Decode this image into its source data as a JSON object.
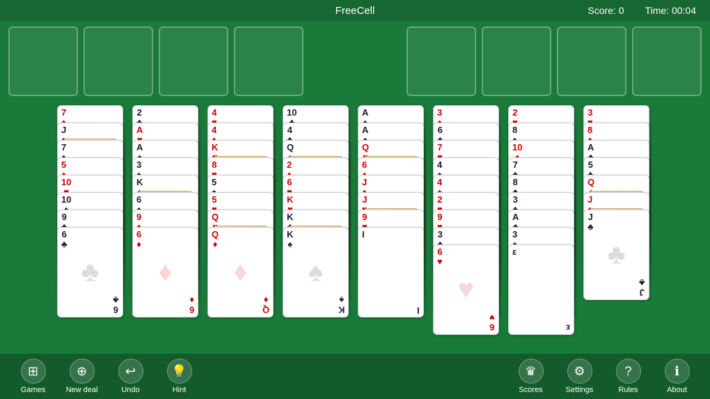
{
  "header": {
    "title": "FreeCell",
    "score_label": "Score:",
    "score_value": "0",
    "time_label": "Time:",
    "time_value": "00:04"
  },
  "toolbar": {
    "left_buttons": [
      {
        "id": "games",
        "label": "Games",
        "icon": "⊞"
      },
      {
        "id": "new-deal",
        "label": "New deal",
        "icon": "⊕"
      },
      {
        "id": "undo",
        "label": "Undo",
        "icon": "↩"
      },
      {
        "id": "hint",
        "label": "Hint",
        "icon": "💡"
      }
    ],
    "right_buttons": [
      {
        "id": "scores",
        "label": "Scores",
        "icon": "♛"
      },
      {
        "id": "settings",
        "label": "Settings",
        "icon": "⚙"
      },
      {
        "id": "rules",
        "label": "Rules",
        "icon": "?"
      },
      {
        "id": "about",
        "label": "About",
        "icon": "ℹ"
      }
    ]
  },
  "columns": [
    {
      "cards": [
        {
          "rank": "7",
          "suit": "♦",
          "color": "red",
          "face": false
        },
        {
          "rank": "J",
          "suit": "♠",
          "color": "black",
          "face": true
        },
        {
          "rank": "7",
          "suit": "♠",
          "color": "black",
          "face": false
        },
        {
          "rank": "5",
          "suit": "♦",
          "color": "red",
          "face": false
        },
        {
          "rank": "10",
          "suit": "♥",
          "color": "red",
          "face": false
        },
        {
          "rank": "10",
          "suit": "♠",
          "color": "black",
          "face": false
        },
        {
          "rank": "9",
          "suit": "♣",
          "color": "black",
          "face": false
        },
        {
          "rank": "6",
          "suit": "♣",
          "color": "black",
          "face": false
        }
      ]
    },
    {
      "cards": [
        {
          "rank": "2",
          "suit": "♣",
          "color": "black",
          "face": false
        },
        {
          "rank": "A",
          "suit": "♥",
          "color": "red",
          "face": false
        },
        {
          "rank": "A",
          "suit": "♠",
          "color": "black",
          "face": false
        },
        {
          "rank": "3",
          "suit": "♠",
          "color": "black",
          "face": false
        },
        {
          "rank": "K",
          "suit": "♠",
          "color": "black",
          "face": true
        },
        {
          "rank": "6",
          "suit": "♠",
          "color": "black",
          "face": false
        },
        {
          "rank": "9",
          "suit": "♦",
          "color": "red",
          "face": false
        },
        {
          "rank": "6",
          "suit": "♦",
          "color": "red",
          "face": false
        }
      ]
    },
    {
      "cards": [
        {
          "rank": "4",
          "suit": "♥",
          "color": "red",
          "face": false
        },
        {
          "rank": "4",
          "suit": "♦",
          "color": "red",
          "face": false
        },
        {
          "rank": "K",
          "suit": "♥",
          "color": "red",
          "face": true
        },
        {
          "rank": "8",
          "suit": "♥",
          "color": "red",
          "face": false
        },
        {
          "rank": "5",
          "suit": "♠",
          "color": "black",
          "face": false
        },
        {
          "rank": "5",
          "suit": "♥",
          "color": "red",
          "face": false
        },
        {
          "rank": "Q",
          "suit": "♥",
          "color": "red",
          "face": true
        },
        {
          "rank": "Q",
          "suit": "♦",
          "color": "red",
          "face": false
        }
      ]
    },
    {
      "cards": [
        {
          "rank": "10",
          "suit": "♣",
          "color": "black",
          "face": false
        },
        {
          "rank": "4",
          "suit": "♣",
          "color": "black",
          "face": false
        },
        {
          "rank": "Q",
          "suit": "♠",
          "color": "black",
          "face": true
        },
        {
          "rank": "2",
          "suit": "♦",
          "color": "red",
          "face": false
        },
        {
          "rank": "6",
          "suit": "♥",
          "color": "red",
          "face": false
        },
        {
          "rank": "K",
          "suit": "♥",
          "color": "red",
          "face": false
        },
        {
          "rank": "K",
          "suit": "♣",
          "color": "black",
          "face": true
        },
        {
          "rank": "K",
          "suit": "♠",
          "color": "black",
          "face": false
        }
      ]
    },
    {
      "cards": [
        {
          "rank": "A",
          "suit": "♠",
          "color": "black",
          "face": false
        },
        {
          "rank": "A",
          "suit": "♠",
          "color": "black",
          "face": false
        },
        {
          "rank": "Q",
          "suit": "♥",
          "color": "red",
          "face": true
        },
        {
          "rank": "6",
          "suit": "♦",
          "color": "red",
          "face": false
        },
        {
          "rank": "J",
          "suit": "♦",
          "color": "red",
          "face": false
        },
        {
          "rank": "J",
          "suit": "♥",
          "color": "red",
          "face": true
        },
        {
          "rank": "9",
          "suit": "♥",
          "color": "red",
          "face": false
        },
        {
          "rank": "I",
          "suit": "",
          "color": "black",
          "face": false
        }
      ]
    },
    {
      "cards": [
        {
          "rank": "3",
          "suit": "♦",
          "color": "red",
          "face": false
        },
        {
          "rank": "6",
          "suit": "♣",
          "color": "black",
          "face": false
        },
        {
          "rank": "7",
          "suit": "♥",
          "color": "red",
          "face": false
        },
        {
          "rank": "4",
          "suit": "♠",
          "color": "black",
          "face": false
        },
        {
          "rank": "4",
          "suit": "♦",
          "color": "red",
          "face": false
        },
        {
          "rank": "2",
          "suit": "♥",
          "color": "red",
          "face": false
        },
        {
          "rank": "9",
          "suit": "♥",
          "color": "red",
          "face": false
        },
        {
          "rank": "3",
          "suit": "♣",
          "color": "black",
          "face": false
        },
        {
          "rank": "6",
          "suit": "♥",
          "color": "red",
          "face": false
        }
      ]
    },
    {
      "cards": [
        {
          "rank": "2",
          "suit": "♥",
          "color": "red",
          "face": false
        },
        {
          "rank": "8",
          "suit": "♠",
          "color": "black",
          "face": false
        },
        {
          "rank": "10",
          "suit": "♦",
          "color": "red",
          "face": false
        },
        {
          "rank": "7",
          "suit": "♣",
          "color": "black",
          "face": false
        },
        {
          "rank": "8",
          "suit": "♣",
          "color": "black",
          "face": false
        },
        {
          "rank": "3",
          "suit": "♣",
          "color": "black",
          "face": false
        },
        {
          "rank": "A",
          "suit": "♣",
          "color": "black",
          "face": false
        },
        {
          "rank": "3",
          "suit": "♠",
          "color": "black",
          "face": false
        },
        {
          "rank": "ε",
          "suit": "",
          "color": "black",
          "face": false
        }
      ]
    },
    {
      "cards": [
        {
          "rank": "3",
          "suit": "♥",
          "color": "red",
          "face": false
        },
        {
          "rank": "8",
          "suit": "♦",
          "color": "red",
          "face": false
        },
        {
          "rank": "A",
          "suit": "♣",
          "color": "black",
          "face": false
        },
        {
          "rank": "5",
          "suit": "♣",
          "color": "black",
          "face": false
        },
        {
          "rank": "Q",
          "suit": "♦",
          "color": "red",
          "face": true
        },
        {
          "rank": "J",
          "suit": "♦",
          "color": "red",
          "face": true
        },
        {
          "rank": "J",
          "suit": "♣",
          "color": "black",
          "face": false
        }
      ]
    }
  ]
}
